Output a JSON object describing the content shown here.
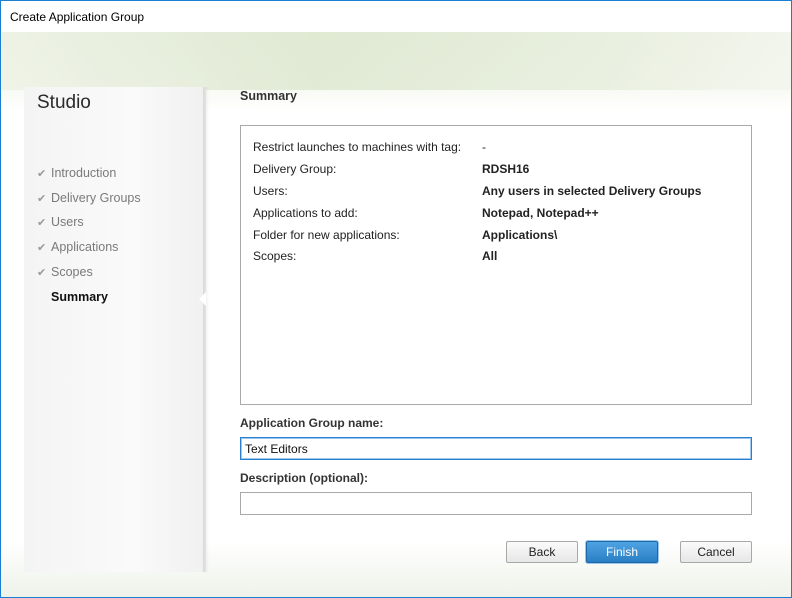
{
  "window": {
    "title": "Create Application Group"
  },
  "sidebar": {
    "brand": "Studio",
    "items": [
      {
        "label": "Introduction",
        "done": true
      },
      {
        "label": "Delivery Groups",
        "done": true
      },
      {
        "label": "Users",
        "done": true
      },
      {
        "label": "Applications",
        "done": true
      },
      {
        "label": "Scopes",
        "done": true
      },
      {
        "label": "Summary",
        "done": false,
        "active": true
      }
    ]
  },
  "main": {
    "title": "Summary",
    "summary": [
      {
        "label": "Restrict launches to machines with tag:",
        "value": "-"
      },
      {
        "label": "Delivery Group:",
        "value": "RDSH16"
      },
      {
        "label": "Users:",
        "value": "Any users in selected Delivery Groups"
      },
      {
        "label": "Applications to add:",
        "value": "Notepad, Notepad++"
      },
      {
        "label": "Folder for new applications:",
        "value": "Applications\\"
      },
      {
        "label": "Scopes:",
        "value": "All"
      }
    ],
    "name_label": "Application Group name:",
    "name_value": "Text Editors",
    "description_label": "Description (optional):",
    "description_value": ""
  },
  "buttons": {
    "back": "Back",
    "finish": "Finish",
    "cancel": "Cancel"
  }
}
